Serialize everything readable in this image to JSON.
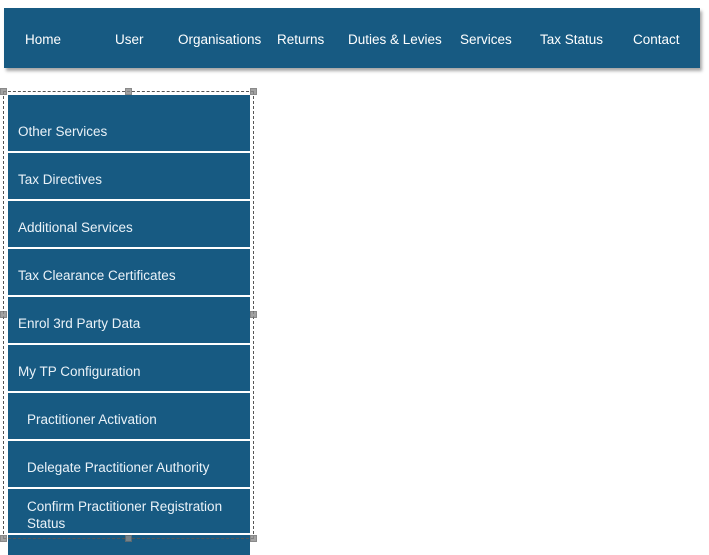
{
  "navbar": {
    "items": [
      {
        "label": "Home"
      },
      {
        "label": "User"
      },
      {
        "label": "Organisations"
      },
      {
        "label": "Returns"
      },
      {
        "label": "Duties & Levies"
      },
      {
        "label": "Services"
      },
      {
        "label": "Tax Status"
      },
      {
        "label": "Contact"
      }
    ]
  },
  "dropdown_menu": {
    "items": [
      {
        "label": "Other Services",
        "indented": false
      },
      {
        "label": "Tax Directives",
        "indented": false
      },
      {
        "label": "Additional Services",
        "indented": false
      },
      {
        "label": "Tax Clearance Certificates",
        "indented": false
      },
      {
        "label": "Enrol 3rd Party Data",
        "indented": false
      },
      {
        "label": "My TP Configuration",
        "indented": false
      },
      {
        "label": "Practitioner Activation",
        "indented": true
      },
      {
        "label": "Delegate Practitioner Authority",
        "indented": true
      },
      {
        "label": "Confirm Practitioner Registration Status",
        "indented": true
      }
    ]
  },
  "colors": {
    "nav_blue": "#175A82",
    "menu_blue": "#175A82",
    "separator": "#FFFFFF",
    "selection_border": "#555555",
    "selection_handle": "#8C8C8C"
  }
}
